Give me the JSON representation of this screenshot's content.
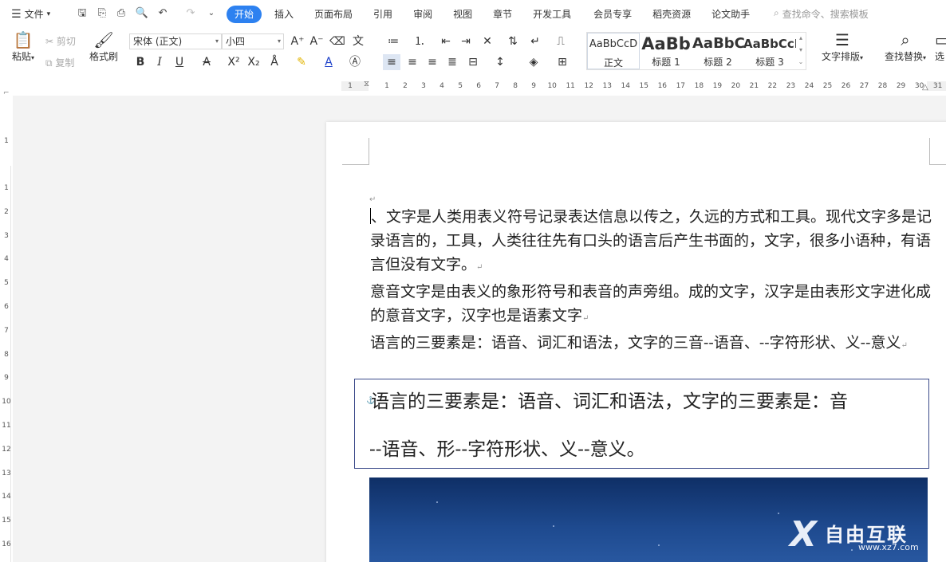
{
  "menubar": {
    "file_label": "文件",
    "tabs": [
      {
        "label": "开始",
        "active": true
      },
      {
        "label": "插入"
      },
      {
        "label": "页面布局"
      },
      {
        "label": "引用"
      },
      {
        "label": "审阅"
      },
      {
        "label": "视图"
      },
      {
        "label": "章节"
      },
      {
        "label": "开发工具"
      },
      {
        "label": "会员专享"
      },
      {
        "label": "稻壳资源"
      },
      {
        "label": "论文助手"
      }
    ],
    "search_placeholder": "查找命令、搜索模板",
    "accent_color": "#2d81f0"
  },
  "ribbon": {
    "paste_label": "粘贴",
    "cut_label": "剪切",
    "copy_label": "复制",
    "format_painter_label": "格式刷",
    "font_name": "宋体 (正文)",
    "font_size": "小四",
    "styles": [
      {
        "sample": "AaBbCcD",
        "label": "正文"
      },
      {
        "sample": "AaBb",
        "label": "标题 1"
      },
      {
        "sample": "AaBbC",
        "label": "标题 2"
      },
      {
        "sample": "AaBbCcI",
        "label": "标题 3"
      }
    ],
    "text_layout_label": "文字排版",
    "find_replace_label": "查找替换",
    "select_label": "选"
  },
  "ruler": {
    "h_ticks": [
      "1",
      "1",
      "2",
      "3",
      "4",
      "5",
      "6",
      "7",
      "8",
      "9",
      "10",
      "11",
      "12",
      "13",
      "14",
      "15",
      "16",
      "17",
      "18",
      "19",
      "20",
      "21",
      "22",
      "23",
      "24",
      "25",
      "26",
      "27",
      "28",
      "29",
      "30",
      "31"
    ],
    "v_ticks": [
      "1",
      "1",
      "2",
      "3",
      "4",
      "5",
      "6",
      "7",
      "8",
      "9",
      "10",
      "11",
      "12",
      "13",
      "14",
      "15",
      "16"
    ]
  },
  "document": {
    "paragraphs": [
      "、文字是人类用表义符号记录表达信息以传之，久远的方式和工具。现代文字多是记录语言的，工具，人类往往先有口头的语言后产生书面的，文字，很多小语种，有语言但没有文字。",
      "意音文字是由表义的象形符号和表音的声旁组。成的文字，汉字是由表形文字进化成的意音文字，汉字也是语素文字",
      "语言的三要素是：语音、词汇和语法，文字的三音--语音、--字符形状、义--意义"
    ],
    "textbox_line1": "语言的三要素是：语音、词汇和语法，文字的三要素是：音",
    "textbox_line2": "--语音、形--字符形状、义--意义。"
  },
  "watermark": {
    "text": "自由互联",
    "url": "www.xz7.com"
  }
}
